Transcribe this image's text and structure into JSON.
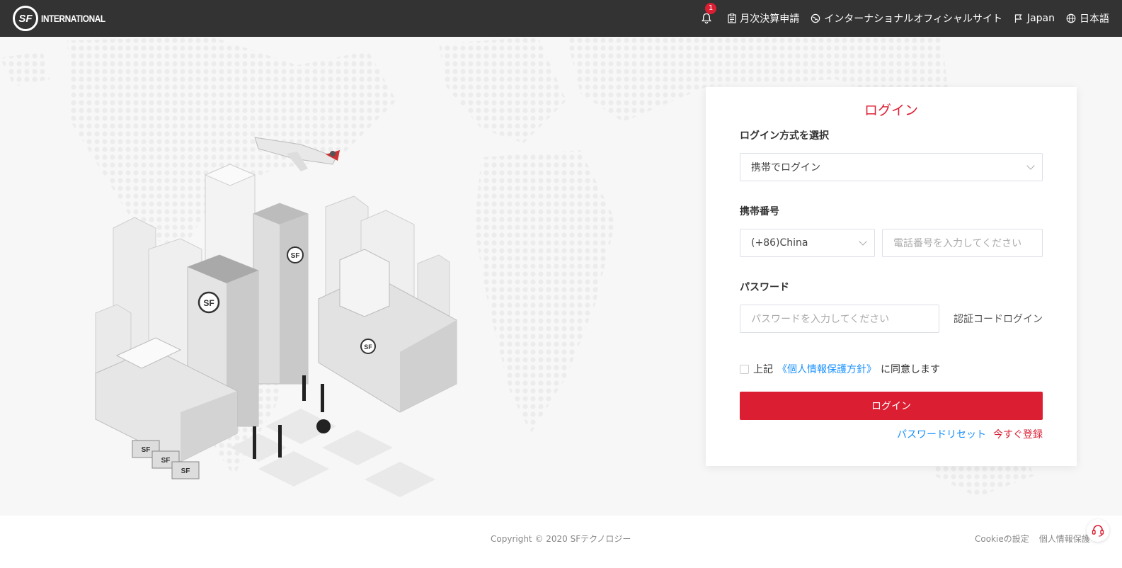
{
  "header": {
    "logo_text": "INTERNATIONAL",
    "logo_mark": "SF",
    "notification_count": "1",
    "nav": {
      "monthly": "月次決算申請",
      "official_site": "インターナショナルオフィシャルサイト",
      "country": "Japan",
      "language": "日本語"
    }
  },
  "login": {
    "title": "ログイン",
    "method_label": "ログイン方式を選択",
    "method_value": "携帯でログイン",
    "phone_label": "携帯番号",
    "country_code": "(+86)China",
    "phone_placeholder": "電話番号を入力してください",
    "password_label": "パスワード",
    "password_placeholder": "パスワードを入力してください",
    "code_login": "認証コードログイン",
    "agree_prefix": "上記",
    "policy_link": "《個人情報保護方針》",
    "agree_suffix": "に同意します",
    "submit": "ログイン",
    "reset": "パスワードリセット",
    "register": "今すぐ登録"
  },
  "footer": {
    "copyright": "Copyright © 2020 SFテクノロジー",
    "cookie": "Cookieの設定",
    "privacy": "個人情報保護"
  },
  "colors": {
    "brand_red": "#dc1e32",
    "header_bg": "#333333",
    "link_blue": "#1890ff"
  }
}
